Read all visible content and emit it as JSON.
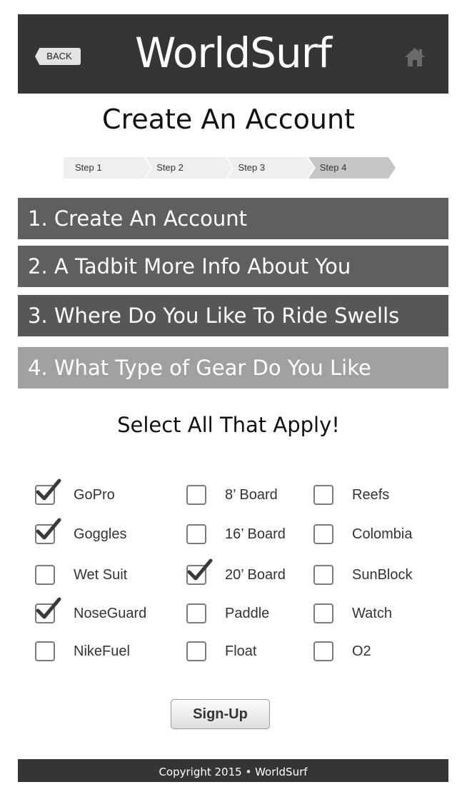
{
  "header": {
    "back_label": "BACK",
    "logo": "WorldSurf",
    "home_icon": "home-icon"
  },
  "page_title": "Create An Account",
  "steps": [
    {
      "label": "Step 1",
      "active": false
    },
    {
      "label": "Step 2",
      "active": false
    },
    {
      "label": "Step 3",
      "active": false
    },
    {
      "label": "Step 4",
      "active": true
    }
  ],
  "sections": [
    "1. Create An Account",
    "2. A Tadbit More Info About You",
    "3. Where Do You Like To Ride Swells",
    "4. What Type of Gear Do You Like"
  ],
  "select_title": "Select All That Apply!",
  "options": {
    "col1": [
      {
        "label": "GoPro",
        "checked": true
      },
      {
        "label": "Goggles",
        "checked": true
      },
      {
        "label": "Wet Suit",
        "checked": false
      },
      {
        "label": "NoseGuard",
        "checked": true
      },
      {
        "label": "NikeFuel",
        "checked": false
      }
    ],
    "col2": [
      {
        "label": "8’ Board",
        "checked": false
      },
      {
        "label": "16’ Board",
        "checked": false
      },
      {
        "label": "20’ Board",
        "checked": true
      },
      {
        "label": "Paddle",
        "checked": false
      },
      {
        "label": "Float",
        "checked": false
      }
    ],
    "col3": [
      {
        "label": "Reefs",
        "checked": false
      },
      {
        "label": "Colombia",
        "checked": false
      },
      {
        "label": "SunBlock",
        "checked": false
      },
      {
        "label": "Watch",
        "checked": false
      },
      {
        "label": "O2",
        "checked": false
      }
    ]
  },
  "signup_label": "Sign-Up",
  "footer": "Copyright 2015 • WorldSurf"
}
